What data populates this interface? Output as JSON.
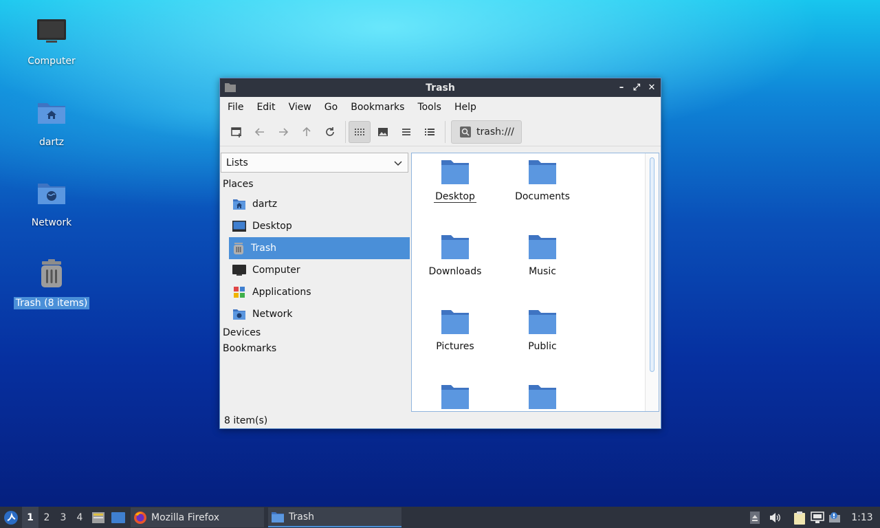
{
  "desktop": {
    "icons": [
      {
        "label": "Computer"
      },
      {
        "label": "dartz"
      },
      {
        "label": "Network"
      },
      {
        "label": "Trash (8 items)"
      }
    ]
  },
  "window": {
    "title": "Trash",
    "controls": {
      "minimize": "–",
      "maximize": "⤢",
      "close": "✕"
    },
    "menu": [
      "File",
      "Edit",
      "View",
      "Go",
      "Bookmarks",
      "Tools",
      "Help"
    ],
    "toolbar": {
      "buttons": [
        "new-tab",
        "back",
        "forward",
        "up",
        "reload",
        "icon-view",
        "thumbnail-view",
        "compact-view",
        "detailed-list-view"
      ],
      "active_view": "icon-view",
      "location": "trash:///"
    },
    "sidebar": {
      "dropdown_value": "Lists",
      "places_header": "Places",
      "places": [
        {
          "label": "dartz",
          "icon": "home-folder-icon"
        },
        {
          "label": "Desktop",
          "icon": "desktop-icon"
        },
        {
          "label": "Trash",
          "icon": "trash-icon",
          "selected": true
        },
        {
          "label": "Computer",
          "icon": "computer-icon"
        },
        {
          "label": "Applications",
          "icon": "applications-icon"
        },
        {
          "label": "Network",
          "icon": "network-icon"
        }
      ],
      "devices_header": "Devices",
      "bookmarks_header": "Bookmarks"
    },
    "files": [
      {
        "label": "Desktop"
      },
      {
        "label": "Documents"
      },
      {
        "label": "Downloads"
      },
      {
        "label": "Music"
      },
      {
        "label": "Pictures"
      },
      {
        "label": "Public"
      },
      {
        "label": ""
      },
      {
        "label": ""
      }
    ],
    "status": "8 item(s)"
  },
  "taskbar": {
    "workspaces": [
      "1",
      "2",
      "3",
      "4"
    ],
    "active_workspace": "1",
    "tasks": [
      {
        "label": "Mozilla Firefox",
        "icon": "firefox-icon"
      },
      {
        "label": "Trash",
        "icon": "folder-icon"
      }
    ],
    "clock": "1:13"
  },
  "colors": {
    "accent": "#4a8fd8",
    "titlebar": "#2f343f",
    "folder": "#4e8ad8",
    "taskbar": "#2d323d"
  }
}
